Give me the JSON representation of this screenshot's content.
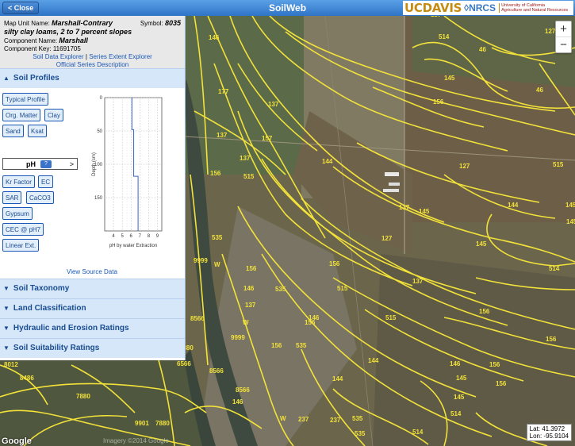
{
  "app": {
    "title": "SoilWeb",
    "close_label": "< Close"
  },
  "logos": {
    "ucdavis": "UCDAVIS",
    "nrcs": "NRCS",
    "uc_line1": "University of California",
    "uc_line2": "Agriculture and Natural Resources"
  },
  "map_unit": {
    "name_label": "Map Unit Name:",
    "name": "Marshall-Contrary",
    "name_line2": "silty clay loams, 2 to 7 percent slopes",
    "symbol_label": "Symbol:",
    "symbol": "8035",
    "component_label": "Component Name:",
    "component": "Marshall",
    "key_label": "Component Key:",
    "key": "11691705",
    "link_sde": "Soil Data Explorer",
    "link_sep": "|",
    "link_see": "Series Extent Explorer",
    "link_osd": "Official Series Description"
  },
  "sections": {
    "profiles": "Soil Profiles",
    "taxonomy": "Soil Taxonomy",
    "land": "Land Classification",
    "hydraulic": "Hydraulic and Erosion Ratings",
    "suitability": "Soil Suitability Ratings"
  },
  "profile_buttons": {
    "typical": "Typical Profile",
    "om": "Org. Matter",
    "clay": "Clay",
    "sand": "Sand",
    "ksat": "Ksat",
    "ph": "pH",
    "ph_help": "?",
    "ph_arrow": ">",
    "kr": "Kr Factor",
    "ec": "EC",
    "sar": "SAR",
    "caco3": "CaCO3",
    "gypsum": "Gypsum",
    "cec": "CEC @ pH7",
    "linear": "Linear Ext."
  },
  "view_source": "View Source Data",
  "chart_data": {
    "type": "line",
    "title": "",
    "xlabel": "pH by water Extraction",
    "ylabel": "Depth (cm)",
    "xlim": [
      3,
      9.5
    ],
    "ylim": [
      200,
      0
    ],
    "xticks": [
      4,
      5,
      6,
      7,
      8,
      9
    ],
    "yticks": [
      0,
      50,
      100,
      150
    ],
    "x": [
      6.1,
      6.1,
      6.3,
      6.3,
      6.8,
      6.8
    ],
    "y": [
      0,
      48,
      48,
      118,
      118,
      200
    ],
    "grid": true,
    "color": "#3a64c8"
  },
  "map": {
    "lat": "Lat: 41.3972",
    "lon": "Lon: -95.9104",
    "zoom_in": "+",
    "zoom_out": "−",
    "google": "Google",
    "copyright": "Imagery ©2014 Google",
    "labels": [
      "146",
      "237",
      "146",
      "137",
      "514",
      "46",
      "127",
      "145",
      "46",
      "177",
      "137",
      "156",
      "137",
      "157",
      "137",
      "144",
      "127",
      "515",
      "145",
      "156",
      "515",
      "144",
      "145",
      "137",
      "145",
      "145",
      "127",
      "535",
      "137",
      "535",
      "9999",
      "156",
      "W",
      "156",
      "514",
      "146",
      "515",
      "137",
      "515",
      "146",
      "156",
      "W",
      "156",
      "144",
      "156",
      "8566",
      "9999",
      "156",
      "535",
      "144",
      "8566",
      "7880",
      "146",
      "156",
      "145",
      "7880",
      "146",
      "145",
      "8012",
      "8486",
      "156",
      "8566",
      "237",
      "535",
      "514",
      "9901",
      "W",
      "237",
      "535",
      "514",
      "7880",
      "6566"
    ]
  }
}
